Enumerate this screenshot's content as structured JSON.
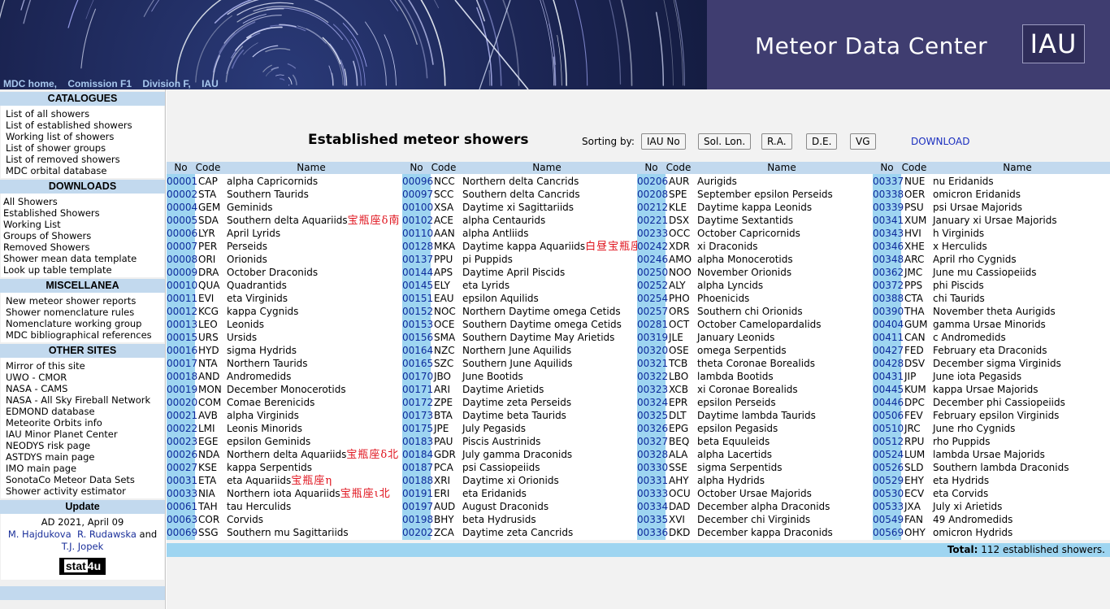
{
  "header": {
    "site_title": "Meteor Data Center",
    "logo_text": "IAU",
    "nav": [
      "MDC home,",
      "Comission F1",
      "Division F,",
      "IAU"
    ]
  },
  "sidebar": {
    "catalogues": {
      "title": "CATALOGUES",
      "items": [
        "List of all showers",
        "List of established showers",
        "Working list of showers",
        "List of shower groups",
        "List of removed showers",
        "MDC orbital database"
      ]
    },
    "downloads": {
      "title": "DOWNLOADS",
      "items": [
        "All Showers",
        "Established Showers",
        "Working List",
        "Groups of Showers",
        "Removed Showers",
        "Shower mean data template",
        "Look up table template"
      ]
    },
    "misc": {
      "title": "MISCELLANEA",
      "items": [
        "New meteor shower reports",
        "Shower nomenclature rules",
        "Nomenclature working group",
        "MDC bibliographical references"
      ]
    },
    "other": {
      "title": "OTHER SITES",
      "items": [
        "Mirror of this site",
        "UWO - CMOR",
        "NASA - CAMS",
        "NASA - All Sky Fireball Network",
        "EDMOND database",
        "Meteorite Orbits info",
        "IAU Minor Planet Center",
        "NEODYS risk page",
        "ASTDYS main page",
        "IMO main page",
        "SonotaCo Meteor Data Sets",
        "Shower activity estimator"
      ]
    },
    "update": {
      "title": "Update",
      "date": "AD 2021, April 09",
      "author1": "M. Hajdukova",
      "author2": "R. Rudawska",
      "and": "and",
      "author3": "T.J. Jopek",
      "counter_a": "stat",
      "counter_b": "4u"
    }
  },
  "main": {
    "title": "Established meteor showers",
    "sort_label": "Sorting by:",
    "sort_buttons": [
      "IAU No",
      "Sol. Lon.",
      "R.A.",
      "D.E.",
      "VG"
    ],
    "download": "DOWNLOAD",
    "headers": {
      "no": "No",
      "code": "Code",
      "name": "Name"
    },
    "total_label": "Total:",
    "total_value": "112 established showers."
  },
  "columns": [
    [
      [
        "00001",
        "CAP",
        "alpha Capricornids"
      ],
      [
        "00002",
        "STA",
        "Southern Taurids"
      ],
      [
        "00004",
        "GEM",
        "Geminids"
      ],
      [
        "00005",
        "SDA",
        "Southern delta Aquariids",
        "宝瓶座δ南"
      ],
      [
        "00006",
        "LYR",
        "April Lyrids"
      ],
      [
        "00007",
        "PER",
        "Perseids"
      ],
      [
        "00008",
        "ORI",
        "Orionids"
      ],
      [
        "00009",
        "DRA",
        "October Draconids"
      ],
      [
        "00010",
        "QUA",
        "Quadrantids"
      ],
      [
        "00011",
        "EVI",
        "eta Virginids"
      ],
      [
        "00012",
        "KCG",
        "kappa Cygnids"
      ],
      [
        "00013",
        "LEO",
        "Leonids"
      ],
      [
        "00015",
        "URS",
        "Ursids"
      ],
      [
        "00016",
        "HYD",
        "sigma Hydrids"
      ],
      [
        "00017",
        "NTA",
        "Northern Taurids"
      ],
      [
        "00018",
        "AND",
        "Andromedids"
      ],
      [
        "00019",
        "MON",
        "December Monocerotids"
      ],
      [
        "00020",
        "COM",
        "Comae Berenicids"
      ],
      [
        "00021",
        "AVB",
        "alpha Virginids"
      ],
      [
        "00022",
        "LMI",
        "Leonis Minorids"
      ],
      [
        "00023",
        "EGE",
        "epsilon Geminids"
      ],
      [
        "00026",
        "NDA",
        "Northern delta Aquariids",
        "宝瓶座δ北"
      ],
      [
        "00027",
        "KSE",
        "kappa Serpentids"
      ],
      [
        "00031",
        "ETA",
        "eta Aquariids",
        "宝瓶座η"
      ],
      [
        "00033",
        "NIA",
        "Northern iota Aquariids",
        "宝瓶座ι北"
      ],
      [
        "00061",
        "TAH",
        "tau Herculids"
      ],
      [
        "00063",
        "COR",
        "Corvids"
      ],
      [
        "00069",
        "SSG",
        "Southern mu Sagittariids"
      ]
    ],
    [
      [
        "00096",
        "NCC",
        "Northern delta Cancrids"
      ],
      [
        "00097",
        "SCC",
        "Southern delta Cancrids"
      ],
      [
        "00100",
        "XSA",
        "Daytime xi Sagittariids"
      ],
      [
        "00102",
        "ACE",
        "alpha Centaurids"
      ],
      [
        "00110",
        "AAN",
        "alpha Antliids"
      ],
      [
        "00128",
        "MKA",
        "Daytime kappa Aquariids",
        "白昼宝瓶座κ"
      ],
      [
        "00137",
        "PPU",
        "pi Puppids"
      ],
      [
        "00144",
        "APS",
        "Daytime April Piscids"
      ],
      [
        "00145",
        "ELY",
        "eta Lyrids"
      ],
      [
        "00151",
        "EAU",
        "epsilon Aquilids"
      ],
      [
        "00152",
        "NOC",
        "Northern Daytime omega Cetids"
      ],
      [
        "00153",
        "OCE",
        "Southern Daytime omega Cetids"
      ],
      [
        "00156",
        "SMA",
        "Southern Daytime May Arietids"
      ],
      [
        "00164",
        "NZC",
        "Northern June Aquilids"
      ],
      [
        "00165",
        "SZC",
        "Southern June Aquilids"
      ],
      [
        "00170",
        "JBO",
        "June Bootids"
      ],
      [
        "00171",
        "ARI",
        "Daytime Arietids"
      ],
      [
        "00172",
        "ZPE",
        "Daytime zeta Perseids"
      ],
      [
        "00173",
        "BTA",
        "Daytime beta Taurids"
      ],
      [
        "00175",
        "JPE",
        "July Pegasids"
      ],
      [
        "00183",
        "PAU",
        "Piscis Austrinids"
      ],
      [
        "00184",
        "GDR",
        "July gamma Draconids"
      ],
      [
        "00187",
        "PCA",
        "psi Cassiopeiids"
      ],
      [
        "00188",
        "XRI",
        "Daytime xi Orionids"
      ],
      [
        "00191",
        "ERI",
        "eta Eridanids"
      ],
      [
        "00197",
        "AUD",
        "August Draconids"
      ],
      [
        "00198",
        "BHY",
        "beta Hydrusids"
      ],
      [
        "00202",
        "ZCA",
        "Daytime zeta Cancrids"
      ]
    ],
    [
      [
        "00206",
        "AUR",
        "Aurigids"
      ],
      [
        "00208",
        "SPE",
        "September epsilon Perseids"
      ],
      [
        "00212",
        "KLE",
        "Daytime kappa Leonids"
      ],
      [
        "00221",
        "DSX",
        "Daytime Sextantids"
      ],
      [
        "00233",
        "OCC",
        "October Capricornids"
      ],
      [
        "00242",
        "XDR",
        "xi Draconids"
      ],
      [
        "00246",
        "AMO",
        "alpha Monocerotids"
      ],
      [
        "00250",
        "NOO",
        "November Orionids"
      ],
      [
        "00252",
        "ALY",
        "alpha Lyncids"
      ],
      [
        "00254",
        "PHO",
        "Phoenicids"
      ],
      [
        "00257",
        "ORS",
        "Southern chi Orionids"
      ],
      [
        "00281",
        "OCT",
        "October Camelopardalids"
      ],
      [
        "00319",
        "JLE",
        "January Leonids"
      ],
      [
        "00320",
        "OSE",
        "omega Serpentids"
      ],
      [
        "00321",
        "TCB",
        "theta Coronae Borealids"
      ],
      [
        "00322",
        "LBO",
        "lambda Bootids"
      ],
      [
        "00323",
        "XCB",
        "xi Coronae Borealids"
      ],
      [
        "00324",
        "EPR",
        "epsilon Perseids"
      ],
      [
        "00325",
        "DLT",
        "Daytime lambda Taurids"
      ],
      [
        "00326",
        "EPG",
        "epsilon Pegasids"
      ],
      [
        "00327",
        "BEQ",
        "beta Equuleids"
      ],
      [
        "00328",
        "ALA",
        "alpha Lacertids"
      ],
      [
        "00330",
        "SSE",
        "sigma Serpentids"
      ],
      [
        "00331",
        "AHY",
        "alpha Hydrids"
      ],
      [
        "00333",
        "OCU",
        "October Ursae Majorids"
      ],
      [
        "00334",
        "DAD",
        "December alpha Draconids"
      ],
      [
        "00335",
        "XVI",
        "December chi Virginids"
      ],
      [
        "00336",
        "DKD",
        "December kappa Draconids"
      ]
    ],
    [
      [
        "00337",
        "NUE",
        "nu Eridanids"
      ],
      [
        "00338",
        "OER",
        "omicron Eridanids"
      ],
      [
        "00339",
        "PSU",
        "psi Ursae Majorids"
      ],
      [
        "00341",
        "XUM",
        "January xi Ursae Majorids"
      ],
      [
        "00343",
        "HVI",
        "h Virginids"
      ],
      [
        "00346",
        "XHE",
        "x Herculids"
      ],
      [
        "00348",
        "ARC",
        "April rho Cygnids"
      ],
      [
        "00362",
        "JMC",
        "June mu Cassiopeiids"
      ],
      [
        "00372",
        "PPS",
        "phi Piscids"
      ],
      [
        "00388",
        "CTA",
        "chi Taurids"
      ],
      [
        "00390",
        "THA",
        "November theta Aurigids"
      ],
      [
        "00404",
        "GUM",
        "gamma Ursae Minorids"
      ],
      [
        "00411",
        "CAN",
        "c Andromedids"
      ],
      [
        "00427",
        "FED",
        "February eta Draconids"
      ],
      [
        "00428",
        "DSV",
        "December sigma Virginids"
      ],
      [
        "00431",
        "JIP",
        "June iota Pegasids"
      ],
      [
        "00445",
        "KUM",
        "kappa Ursae Majorids"
      ],
      [
        "00446",
        "DPC",
        "December phi Cassiopeiids"
      ],
      [
        "00506",
        "FEV",
        "February epsilon Virginids"
      ],
      [
        "00510",
        "JRC",
        "June rho Cygnids"
      ],
      [
        "00512",
        "RPU",
        "rho Puppids"
      ],
      [
        "00524",
        "LUM",
        "lambda Ursae Majorids"
      ],
      [
        "00526",
        "SLD",
        "Southern lambda Draconids"
      ],
      [
        "00529",
        "EHY",
        "eta Hydrids"
      ],
      [
        "00530",
        "ECV",
        "eta Corvids"
      ],
      [
        "00533",
        "JXA",
        "July xi Arietids"
      ],
      [
        "00549",
        "FAN",
        "49 Andromedids"
      ],
      [
        "00569",
        "OHY",
        "omicron Hydrids"
      ]
    ]
  ]
}
